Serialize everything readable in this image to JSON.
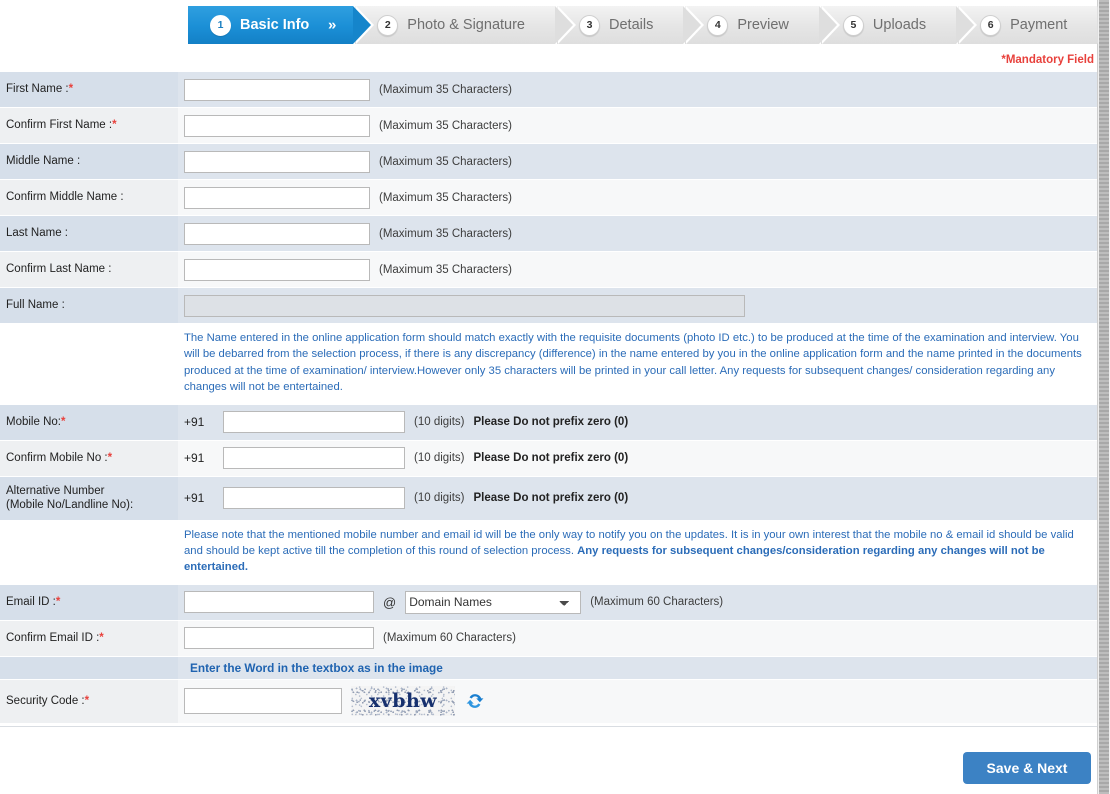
{
  "wizard": {
    "steps": [
      {
        "num": "1",
        "label": "Basic Info",
        "active": true
      },
      {
        "num": "2",
        "label": "Photo & Signature",
        "active": false
      },
      {
        "num": "3",
        "label": "Details",
        "active": false
      },
      {
        "num": "4",
        "label": "Preview",
        "active": false
      },
      {
        "num": "5",
        "label": "Uploads",
        "active": false
      },
      {
        "num": "6",
        "label": "Payment",
        "active": false
      }
    ],
    "active_chevron": "»"
  },
  "mandatory_note": "*Mandatory Field",
  "colors": {
    "active_step": "#1b8fd6",
    "mandatory_red": "#e8413c",
    "note_blue": "#2b6cb8",
    "button_blue": "#3c82c4",
    "row_tint": "#dde4ed"
  },
  "fields": {
    "first_name": {
      "label": "First Name :",
      "required": true,
      "value": "",
      "hint": "(Maximum 35 Characters)"
    },
    "confirm_first_name": {
      "label": "Confirm First Name :",
      "required": true,
      "value": "",
      "hint": "(Maximum 35 Characters)"
    },
    "middle_name": {
      "label": "Middle Name :",
      "required": false,
      "value": "",
      "hint": "(Maximum 35 Characters)"
    },
    "confirm_middle_name": {
      "label": "Confirm Middle Name :",
      "required": false,
      "value": "",
      "hint": "(Maximum 35 Characters)"
    },
    "last_name": {
      "label": "Last Name :",
      "required": false,
      "value": "",
      "hint": "(Maximum 35 Characters)"
    },
    "confirm_last_name": {
      "label": "Confirm Last Name :",
      "required": false,
      "value": "",
      "hint": "(Maximum 35 Characters)"
    },
    "full_name": {
      "label": "Full Name :",
      "required": false,
      "value": ""
    },
    "mobile": {
      "label": "Mobile No:",
      "required": true,
      "prefix": "+91",
      "value": "",
      "hint": "(10 digits)",
      "hint_bold": "Please Do not prefix zero (0)"
    },
    "confirm_mobile": {
      "label": "Confirm Mobile No :",
      "required": true,
      "prefix": "+91",
      "value": "",
      "hint": "(10 digits)",
      "hint_bold": "Please Do not prefix zero (0)"
    },
    "alternative_number": {
      "label_line1": "Alternative Number",
      "label_line2": "(Mobile No/Landline No):",
      "required": false,
      "prefix": "+91",
      "value": "",
      "hint": "(10 digits)",
      "hint_bold": "Please Do not prefix zero (0)"
    },
    "email": {
      "label": "Email ID :",
      "required": true,
      "value": "",
      "at": "@",
      "domain_selected": "Domain Names",
      "hint": "(Maximum 60 Characters)"
    },
    "confirm_email": {
      "label": "Confirm Email ID :",
      "required": true,
      "value": "",
      "hint": "(Maximum 60 Characters)"
    },
    "security_code": {
      "label": "Security Code :",
      "required": true,
      "value": "",
      "captcha_text": "xvbhw"
    }
  },
  "notes": {
    "name_note": "The Name entered in the online application form should match exactly with the requisite documents (photo ID etc.) to be produced at the time of the examination and interview. You will be debarred from the selection process, if there is any discrepancy (difference) in the name entered by you in the online application form and the name printed in the documents produced at the time of examination/ interview.However only 35 characters will be printed in your call letter. Any requests for subsequent changes/ consideration regarding any changes will not be entertained.",
    "contact_note_plain": "Please note that the mentioned mobile number and email id will be the only way to notify you on the updates. It is in your own interest that the mobile no & email id should be valid and should be kept active till the completion of this round of selection process. ",
    "contact_note_bold": "Any requests for subsequent changes/consideration regarding any changes will not be entertained.",
    "captcha_instruction": "Enter the Word in the textbox as in the image"
  },
  "footer": {
    "save_label": "Save & Next"
  }
}
